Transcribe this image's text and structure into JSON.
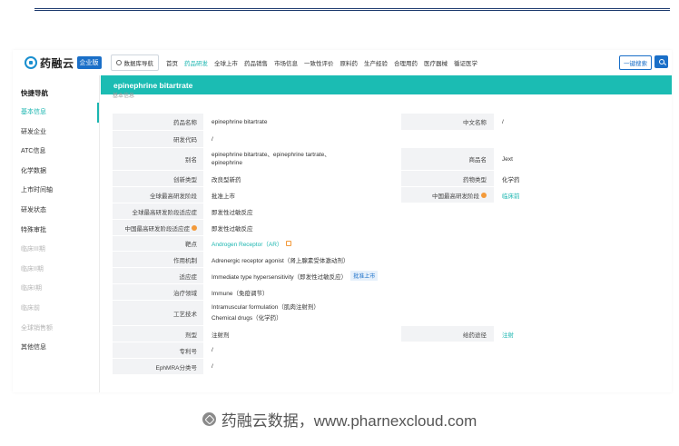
{
  "header": {
    "logo_text": "药融云",
    "logo_badge": "企业版",
    "db_nav": "数据库导航",
    "nav": [
      "首页",
      "药品研发",
      "全球上市",
      "药品销售",
      "市场信息",
      "一致性评价",
      "原料药",
      "生产经验",
      "合理用药",
      "医疗器械",
      "循证医学"
    ],
    "active_nav": "药品研发",
    "search_button": "一键搜索"
  },
  "sidebar": {
    "title": "快捷导航",
    "items": [
      {
        "label": "基本信息",
        "state": "active"
      },
      {
        "label": "研发企业",
        "state": "normal"
      },
      {
        "label": "ATC信息",
        "state": "normal"
      },
      {
        "label": "化学数据",
        "state": "normal"
      },
      {
        "label": "上市时间轴",
        "state": "normal"
      },
      {
        "label": "研发状态",
        "state": "normal"
      },
      {
        "label": "特殊审批",
        "state": "normal"
      },
      {
        "label": "临床III期",
        "state": "muted"
      },
      {
        "label": "临床II期",
        "state": "muted"
      },
      {
        "label": "临床I期",
        "state": "muted"
      },
      {
        "label": "临床前",
        "state": "muted"
      },
      {
        "label": "全球销售额",
        "state": "muted"
      },
      {
        "label": "其他信息",
        "state": "normal"
      }
    ]
  },
  "banner": {
    "title": "epinephrine bitartrate",
    "sub_label": "基本信息"
  },
  "info": {
    "drug_name_label": "药品名称",
    "drug_name": "epinephrine bitartrate",
    "cn_name_label": "中文名称",
    "cn_name": "/",
    "code_label": "研发代码",
    "code": "/",
    "alias_label": "别名",
    "alias": "epinephrine bitartrate、epinephrine tartrate、epinephrine",
    "trade_label": "商品名",
    "trade": "Jext",
    "innov_label": "创新类型",
    "innov": "改良型新药",
    "type_label": "药物类型",
    "type": "化学药",
    "global_stage_label": "全球最高研发阶段",
    "global_stage": "批准上市",
    "cn_stage_label": "中国最高研发阶段",
    "cn_stage": "临床前",
    "global_ind_label": "全球最高研发阶段适应症",
    "global_ind": "即发性过敏反应",
    "cn_ind_label": "中国最高研发阶段适应症",
    "cn_ind": "即发性过敏反应",
    "target_label": "靶点",
    "target": "Androgen Receptor（AR）",
    "mech_label": "作用机制",
    "mech": "Adrenergic receptor agonist（肾上腺素受体激动剂）",
    "indication_label": "适应症",
    "indication": "Immediate type hypersensitivity（即发性过敏反应）",
    "indication_tag": "批准上市",
    "thera_label": "治疗领域",
    "thera": "Immune（免疫调节）",
    "tech_label": "工艺技术",
    "tech_1": "Intramuscular formulation（肌肉注射剂）",
    "tech_2": "Chemical drugs（化学药）",
    "form_label": "剂型",
    "form": "注射剂",
    "route_label": "给药途径",
    "route": "注射",
    "patent_label": "专利号",
    "patent": "/",
    "ephmra_label": "EphMRA分类号",
    "ephmra": "/"
  },
  "footer": {
    "text": "药融云数据，www.pharnexcloud.com"
  },
  "colors": {
    "accent": "#1bbcb3",
    "brand_blue": "#1a6fc8",
    "label_bg": "#f2f3f5"
  }
}
